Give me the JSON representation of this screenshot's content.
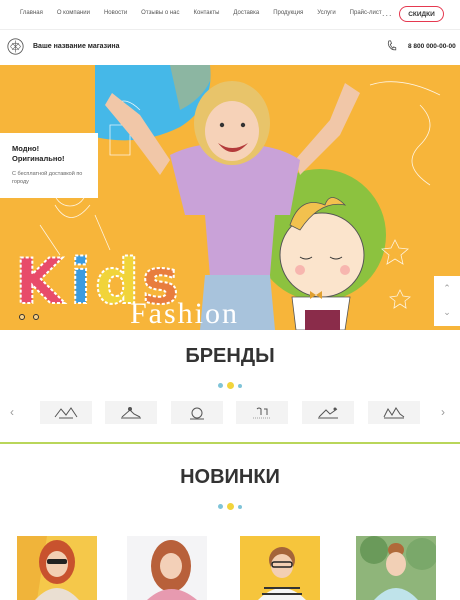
{
  "nav": {
    "items": [
      "Главная",
      "О компании",
      "Новости",
      "Отзывы о нас",
      "Контакты",
      "Доставка",
      "Продукция",
      "Услуги",
      "Прайс-лист"
    ],
    "more_label": "...",
    "sale_label": "СКИДКИ"
  },
  "header": {
    "shop_name": "Ваше название магазина",
    "phone": "8 800 000-00-00"
  },
  "hero": {
    "promo_title_line1": "Модно!",
    "promo_title_line2": "Оригинально!",
    "promo_subtitle": "С бесплатной доставкой по городу",
    "kids_word": "Kids",
    "fashion_word": "Fashion",
    "slide_count": 2,
    "arrow_up": "⌃",
    "arrow_down": "⌄"
  },
  "brands": {
    "title": "БРЕНДЫ",
    "prev_arrow": "‹",
    "next_arrow": "›",
    "logo_count": 6
  },
  "news": {
    "title": "НОВИНКИ",
    "cards": [
      "photo-girl-sunglasses",
      "photo-girl-curly",
      "photo-boy-glasses",
      "photo-girl-bun"
    ]
  },
  "colors": {
    "accent_red": "#e53950",
    "hero_orange": "#f7b53a",
    "hero_blue": "#45b8e8",
    "hero_green": "#8cc23f",
    "divider_green": "#b9d65a",
    "dot_blue": "#7fc4d8",
    "dot_yellow": "#f2d43c"
  }
}
